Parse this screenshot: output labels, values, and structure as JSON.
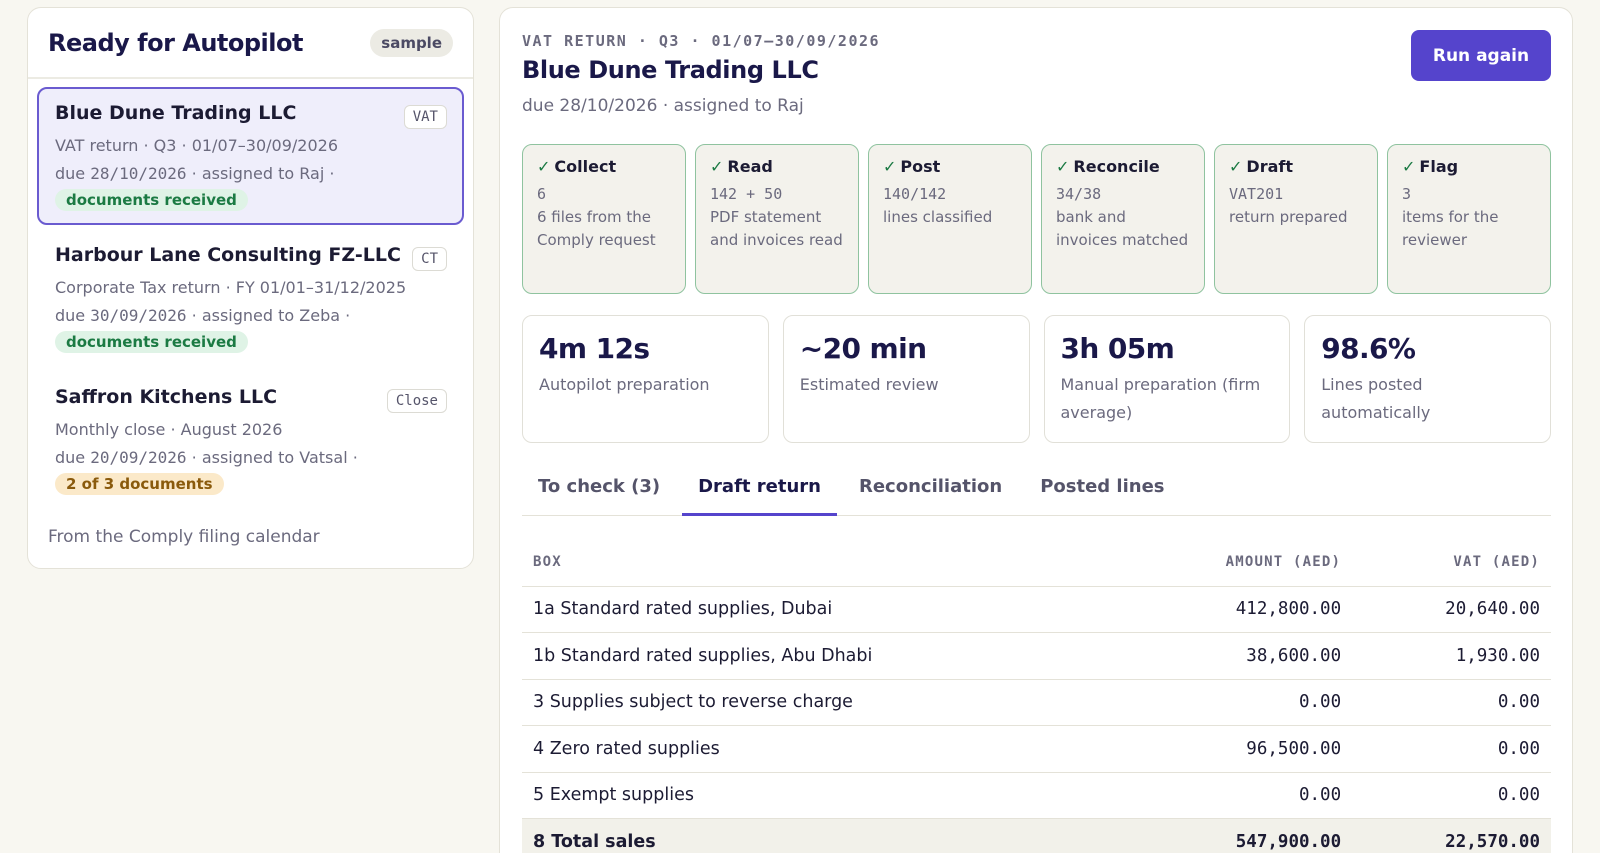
{
  "sidebar": {
    "title": "Ready for Autopilot",
    "badge": "sample",
    "jobs": [
      {
        "name": "Blue Dune Trading LLC",
        "tag": "VAT",
        "line1": "VAT return · Q3 · 01/07–30/09/2026",
        "due_date": "28/10/2026",
        "due_rest": " · assigned to Raj ·",
        "status": "documents received"
      },
      {
        "name": "Harbour Lane Consulting FZ-LLC",
        "tag": "CT",
        "line1": "Corporate Tax return · FY 01/01–31/12/2025",
        "due_date": "30/09/2026",
        "due_rest": " · assigned to Zeba ·",
        "status": "documents received"
      },
      {
        "name": "Saffron Kitchens LLC",
        "tag": "Close",
        "line1": "Monthly close · August 2026",
        "due_date": "20/09/2026",
        "due_rest": " · assigned to Vatsal ·",
        "status": "2 of 3 documents"
      }
    ],
    "due_prefix": "due ",
    "footer": "From the Comply filing calendar"
  },
  "detail": {
    "eyebrow": "VAT RETURN · Q3 · 01/07–30/09/2026",
    "title": "Blue Dune Trading LLC",
    "due_line": "due 28/10/2026 · assigned to Raj",
    "run_label": "Run again",
    "check_glyph": "✓",
    "steps": [
      {
        "title": "Collect",
        "value": "6",
        "desc": "6 files from the Comply request"
      },
      {
        "title": "Read",
        "value": "142 + 50",
        "desc": "PDF statement and invoices read"
      },
      {
        "title": "Post",
        "value": "140/142",
        "desc": "lines classified"
      },
      {
        "title": "Reconcile",
        "value": "34/38",
        "desc": "bank and invoices matched"
      },
      {
        "title": "Draft",
        "value": "VAT201",
        "desc": "return prepared"
      },
      {
        "title": "Flag",
        "value": "3",
        "desc": "items for the reviewer"
      }
    ],
    "metrics": [
      {
        "value": "4m 12s",
        "label": "Autopilot preparation"
      },
      {
        "value": "~20 min",
        "label": "Estimated review"
      },
      {
        "value": "3h 05m",
        "label": "Manual preparation (firm average)"
      },
      {
        "value": "98.6%",
        "label": "Lines posted automatically"
      }
    ],
    "tabs": [
      {
        "label": "To check (3)"
      },
      {
        "label": "Draft return"
      },
      {
        "label": "Reconciliation"
      },
      {
        "label": "Posted lines"
      }
    ],
    "table": {
      "headers": {
        "box": "BOX",
        "amount": "AMOUNT (AED)",
        "vat": "VAT (AED)"
      },
      "rows": [
        {
          "box": "1a Standard rated supplies, Dubai",
          "amount": "412,800.00",
          "vat": "20,640.00"
        },
        {
          "box": "1b Standard rated supplies, Abu Dhabi",
          "amount": "38,600.00",
          "vat": "1,930.00"
        },
        {
          "box": "3 Supplies subject to reverse charge",
          "amount": "0.00",
          "vat": "0.00"
        },
        {
          "box": "4 Zero rated supplies",
          "amount": "96,500.00",
          "vat": "0.00"
        },
        {
          "box": "5 Exempt supplies",
          "amount": "0.00",
          "vat": "0.00"
        },
        {
          "box": "8 Total sales",
          "amount": "547,900.00",
          "vat": "22,570.00"
        }
      ]
    }
  }
}
